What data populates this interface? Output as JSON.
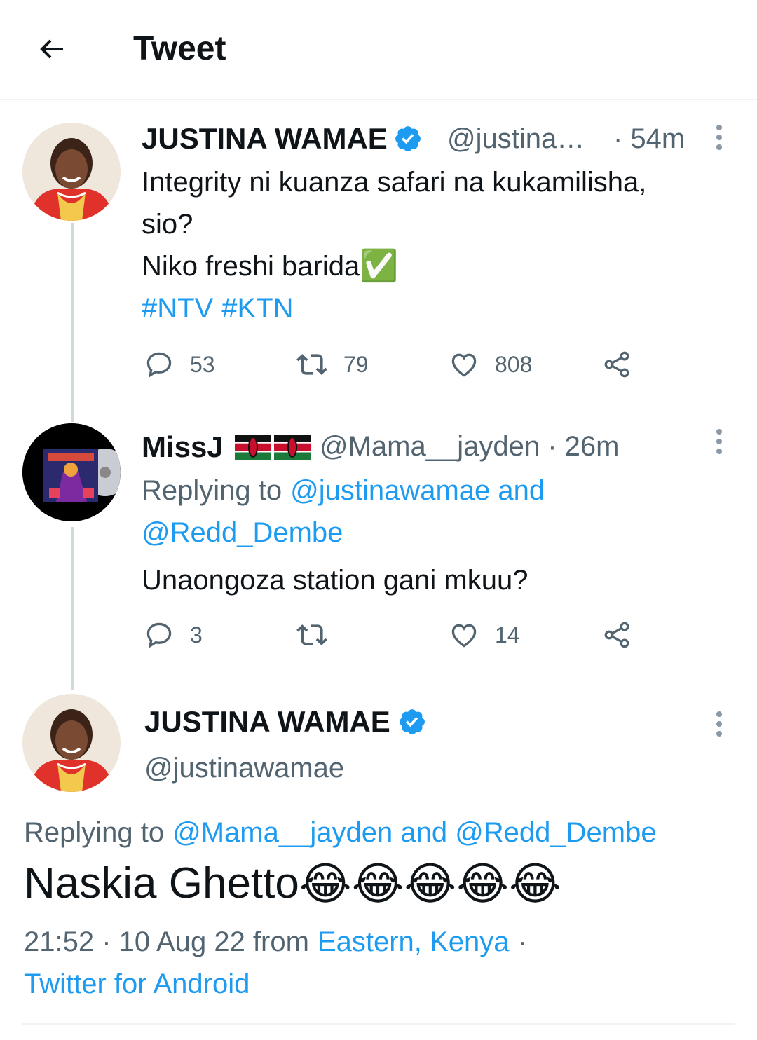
{
  "header": {
    "title": "Tweet"
  },
  "tweet1": {
    "name": "JUSTINA WAMAE",
    "handle": "@justina…",
    "time": "· 54m",
    "line1": "Integrity ni kuanza safari na kukamilisha,",
    "line2": "sio?",
    "line3": "Niko freshi barida",
    "line3_emoji": "✅",
    "hashtag1": "#NTV",
    "hashtag2": "#KTN",
    "replies": "53",
    "retweets": "79",
    "likes": "808"
  },
  "tweet2": {
    "name": "MissJ",
    "flags": "🇰🇪🇰🇪",
    "handle_time": "@Mama__jayden · 26m",
    "replying_prefix": "Replying to",
    "replying_links_1": "@justinawamae and",
    "replying_links_2": "@Redd_Dembe",
    "text": "Unaongoza station gani mkuu?",
    "replies": "3",
    "retweets": "",
    "likes": "14"
  },
  "main_tweet": {
    "name": "JUSTINA WAMAE",
    "handle": "@justinawamae",
    "replying_prefix": "Replying to",
    "replying_links": "@Mama__jayden and @Redd_Dembe",
    "text": "Naskia Ghetto",
    "emojis": "😂😂😂😂😂",
    "timestamp": "21:52 · 10 Aug 22 from",
    "location": "Eastern, Kenya",
    "dot": "·",
    "source": "Twitter for Android"
  },
  "colors": {
    "accent": "#1d9bf0",
    "muted": "#536471",
    "verified": "#1d9bf0"
  },
  "icons": [
    "back-arrow-icon",
    "verified-badge-icon",
    "more-vertical-icon",
    "reply-icon",
    "retweet-icon",
    "like-icon",
    "share-icon"
  ]
}
